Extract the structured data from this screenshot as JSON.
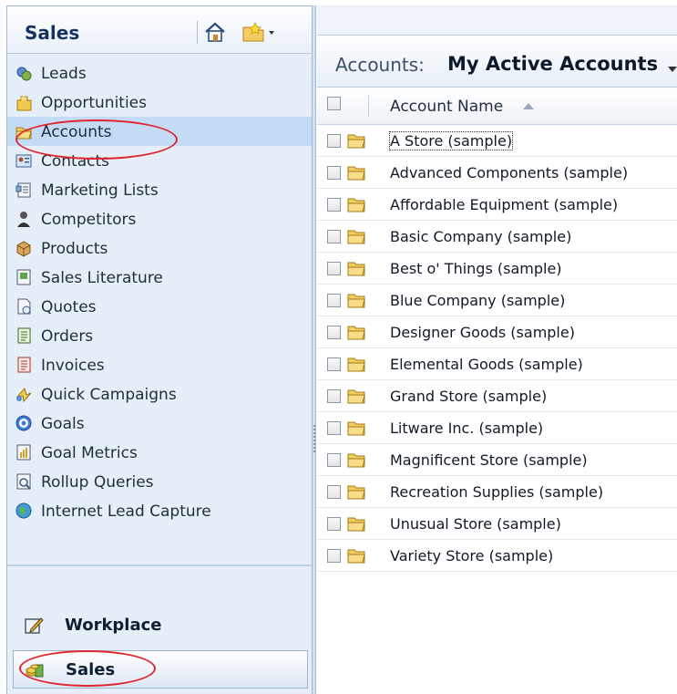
{
  "nav": {
    "title": "Sales",
    "items": [
      {
        "label": "Leads",
        "icon": "leads-icon"
      },
      {
        "label": "Opportunities",
        "icon": "opportunities-icon"
      },
      {
        "label": "Accounts",
        "icon": "accounts-folder-icon"
      },
      {
        "label": "Contacts",
        "icon": "contacts-card-icon"
      },
      {
        "label": "Marketing Lists",
        "icon": "marketing-lists-icon"
      },
      {
        "label": "Competitors",
        "icon": "competitor-person-icon"
      },
      {
        "label": "Products",
        "icon": "product-box-icon"
      },
      {
        "label": "Sales Literature",
        "icon": "sales-literature-icon"
      },
      {
        "label": "Quotes",
        "icon": "quote-document-icon"
      },
      {
        "label": "Orders",
        "icon": "order-document-icon"
      },
      {
        "label": "Invoices",
        "icon": "invoice-document-icon"
      },
      {
        "label": "Quick Campaigns",
        "icon": "quick-campaign-icon"
      },
      {
        "label": "Goals",
        "icon": "goal-target-icon"
      },
      {
        "label": "Goal Metrics",
        "icon": "goal-metrics-icon"
      },
      {
        "label": "Rollup Queries",
        "icon": "rollup-query-icon"
      },
      {
        "label": "Internet Lead Capture",
        "icon": "globe-icon"
      }
    ],
    "selected_index": 2,
    "workareas": [
      {
        "label": "Workplace",
        "icon": "workplace-icon"
      },
      {
        "label": "Sales",
        "icon": "sales-coins-icon"
      }
    ]
  },
  "view": {
    "prefix": "Accounts:",
    "name": "My Active Accounts"
  },
  "grid": {
    "column_header": "Account Name",
    "rows": [
      "A Store (sample)",
      "Advanced Components (sample)",
      "Affordable Equipment (sample)",
      "Basic Company (sample)",
      "Best o' Things (sample)",
      "Blue Company (sample)",
      "Designer Goods (sample)",
      "Elemental Goods (sample)",
      "Grand Store (sample)",
      "Litware Inc. (sample)",
      "Magnificent Store (sample)",
      "Recreation Supplies (sample)",
      "Unusual Store (sample)",
      "Variety Store (sample)"
    ]
  },
  "colors": {
    "nav_bg": "#e6eef8",
    "selected_bg": "#c4dbf5",
    "annotation_red": "#e0262d"
  }
}
